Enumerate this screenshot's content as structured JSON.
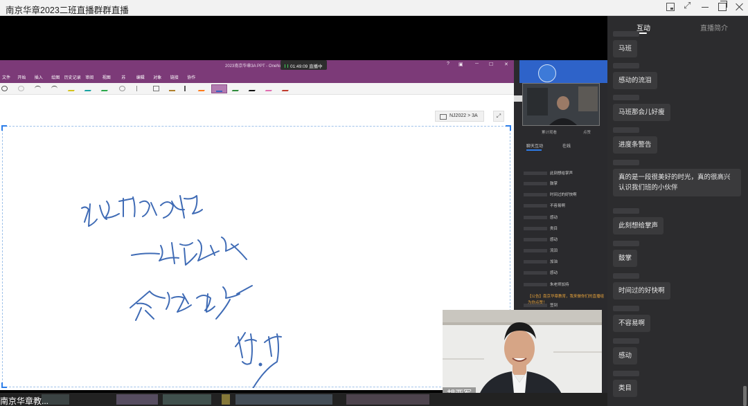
{
  "window": {
    "title": "南京华章2023二班直播群群直播"
  },
  "onenote": {
    "doc_title": "2023南京华章3A PPT - OneNo",
    "timer": "01:49:09",
    "live_label": "直播中",
    "win_help": "?",
    "ribbon": [
      "文件",
      "开始",
      "插入",
      "绘图",
      "历史记录",
      "审阅",
      "视图",
      "苏",
      "编辑",
      "对象",
      "链接",
      "协作"
    ],
    "breadcrumb": "NJ2022 > 3A",
    "handwriting": [
      "祝同学们",
      "一战成硕",
      "金榜题名",
      "胡亚军"
    ],
    "pen_colors": [
      "#2f5fae",
      "#d4c21a",
      "#17a3a3",
      "#2aa84a",
      "#9a9a9a",
      "#b0802c",
      "#ff7a1a",
      "#3a5fbf",
      "#2e8b3a",
      "#111111",
      "#e06db0",
      "#c0392b"
    ]
  },
  "inner_app": {
    "stat_left": "累计观看",
    "stat_right": "点赞",
    "tab_chat": "聊天互动",
    "tab_online": "在线",
    "messages": [
      "此刻想给掌声",
      "鼓掌",
      "时间过的好快啊",
      "不容易啊",
      "感动",
      "类目",
      "感动",
      "流泪",
      "加油",
      "感动",
      "朱老师加持",
      "签到",
      "感动"
    ],
    "system_notice": "【公告】南京华章教育，我来做你们的直播组为你点赞！"
  },
  "teacher": {
    "name": "胡亚军"
  },
  "taskbar": {
    "label": "南京华章教..."
  },
  "panel": {
    "tabs": [
      "互动",
      "直播简介"
    ],
    "comments": [
      "马班",
      "感动的流泪",
      "马班那会儿好瘦",
      "进度条警告",
      "真的是一段很美好的时光，真的很高兴认识我们班的小伙伴",
      "此刻想给掌声",
      "鼓掌",
      "时间过的好快啊",
      "不容易啊",
      "感动",
      "类目"
    ],
    "name_hints": [
      "",
      "",
      "",
      "",
      "",
      "",
      "",
      "",
      "",
      "马",
      "装"
    ]
  }
}
